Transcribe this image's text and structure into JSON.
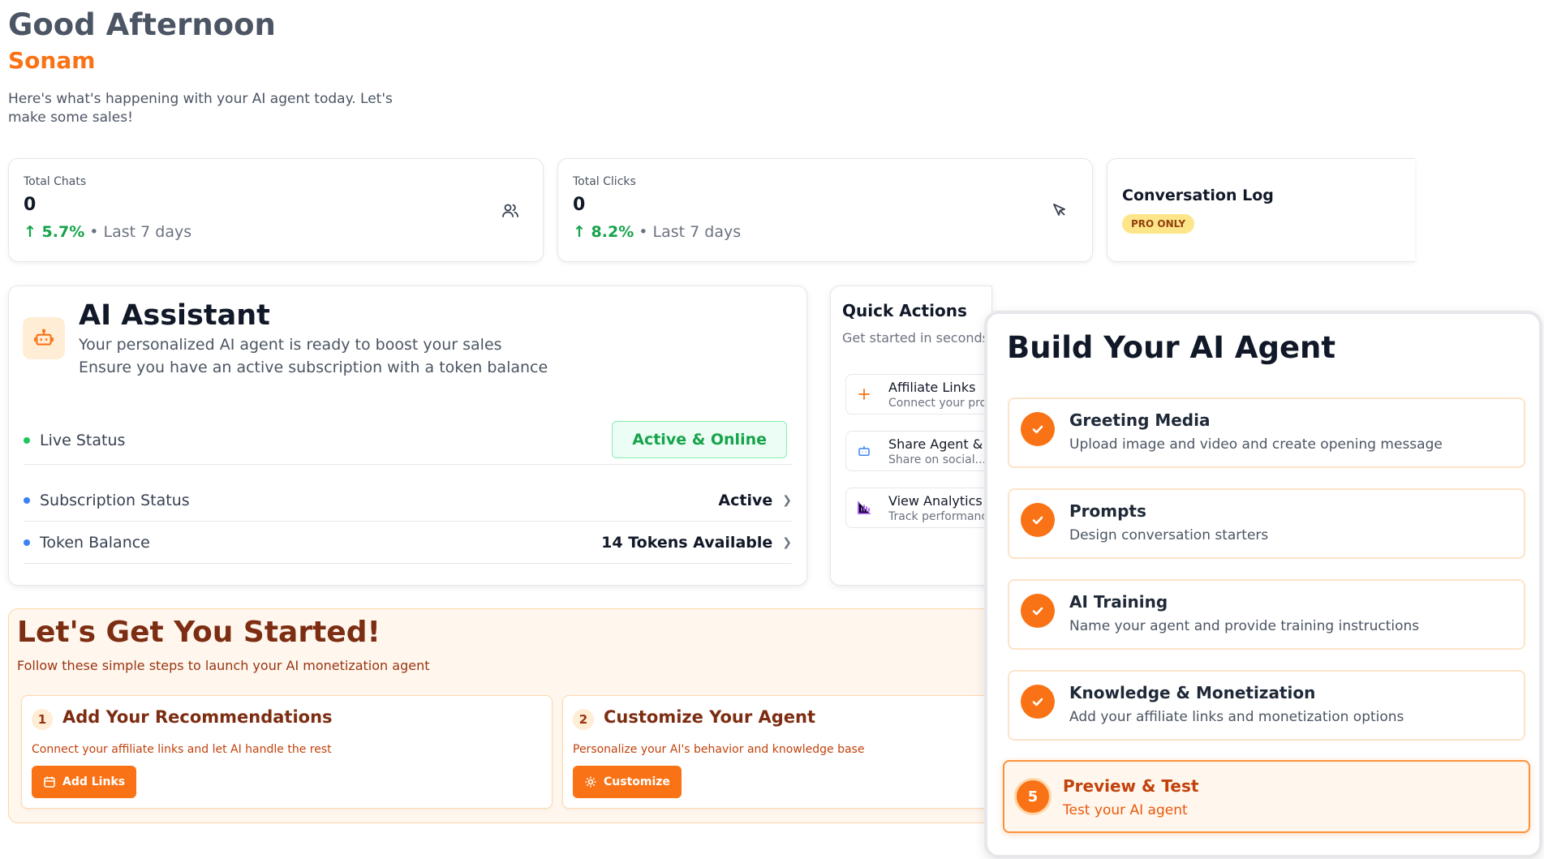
{
  "greeting": {
    "title": "Good Afternoon",
    "name": "Sonam",
    "subtitle": "Here's what's happening with your AI agent today. Let's make some sales!"
  },
  "stats": [
    {
      "label": "Total Chats",
      "value": "0",
      "trend": "5.7%",
      "period": "• Last 7 days",
      "icon": "users-icon"
    },
    {
      "label": "Total Clicks",
      "value": "0",
      "trend": "8.2%",
      "period": "• Last 7 days",
      "icon": "cursor-icon"
    }
  ],
  "conversation_log": {
    "title": "Conversation Log",
    "badge": "PRO ONLY"
  },
  "assistant": {
    "title": "AI Assistant",
    "desc1": "Your personalized AI agent is ready to boost your sales",
    "desc2": "Ensure you have an active subscription with a token balance",
    "live_label": "Live Status",
    "live_value": "Active & Online",
    "subscription_label": "Subscription Status",
    "subscription_value": "Active",
    "token_label": "Token Balance",
    "token_value": "14 Tokens Available"
  },
  "quick_actions": {
    "title": "Quick Actions",
    "subtitle": "Get started in seconds",
    "items": [
      {
        "label": "Affiliate Links",
        "desc": "Connect your products",
        "icon": "plus-icon"
      },
      {
        "label": "Share Agent & ...",
        "desc": "Share on social...",
        "icon": "robot-icon"
      },
      {
        "label": "View Analytics",
        "desc": "Track performance",
        "icon": "bar-chart-icon"
      }
    ]
  },
  "get_started": {
    "title": "Let's Get You Started!",
    "subtitle": "Follow these simple steps to launch your AI monetization agent",
    "steps": [
      {
        "num": "1",
        "title": "Add Your Recommendations",
        "desc": "Connect your affiliate links and let AI handle the rest",
        "button": "Add Links"
      },
      {
        "num": "2",
        "title": "Customize Your Agent",
        "desc": "Personalize your AI's behavior and knowledge base",
        "button": "Customize"
      }
    ]
  },
  "build": {
    "title": "Build Your AI Agent",
    "steps": [
      {
        "title": "Greeting Media",
        "desc": "Upload image and video and create opening message"
      },
      {
        "title": "Prompts",
        "desc": "Design conversation starters"
      },
      {
        "title": "AI Training",
        "desc": "Name your agent and provide training instructions"
      },
      {
        "title": "Knowledge & Monetization",
        "desc": "Add your affiliate links and monetization options"
      },
      {
        "num": "5",
        "title": "Preview & Test",
        "desc": "Test your AI agent"
      }
    ]
  },
  "colors": {
    "accent": "#f97316",
    "success": "#16a34a"
  }
}
